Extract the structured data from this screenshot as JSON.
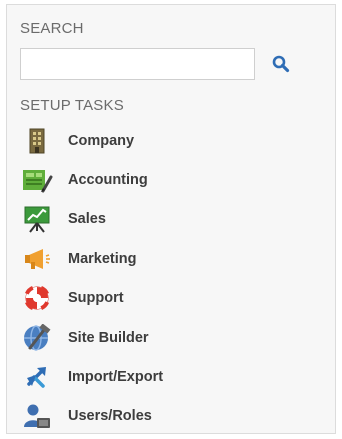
{
  "search": {
    "title": "SEARCH",
    "input_value": "",
    "placeholder": "",
    "button_icon": "magnifier-icon",
    "accent_color": "#2f6db5"
  },
  "setup_tasks": {
    "title": "SETUP TASKS",
    "items": [
      {
        "label": "Company",
        "icon": "building-icon"
      },
      {
        "label": "Accounting",
        "icon": "ledger-icon"
      },
      {
        "label": "Sales",
        "icon": "presentation-chart-icon"
      },
      {
        "label": "Marketing",
        "icon": "megaphone-icon"
      },
      {
        "label": "Support",
        "icon": "lifebuoy-icon"
      },
      {
        "label": "Site Builder",
        "icon": "globe-hammer-icon"
      },
      {
        "label": "Import/Export",
        "icon": "transfer-arrows-icon"
      },
      {
        "label": "Users/Roles",
        "icon": "users-icon"
      }
    ]
  }
}
